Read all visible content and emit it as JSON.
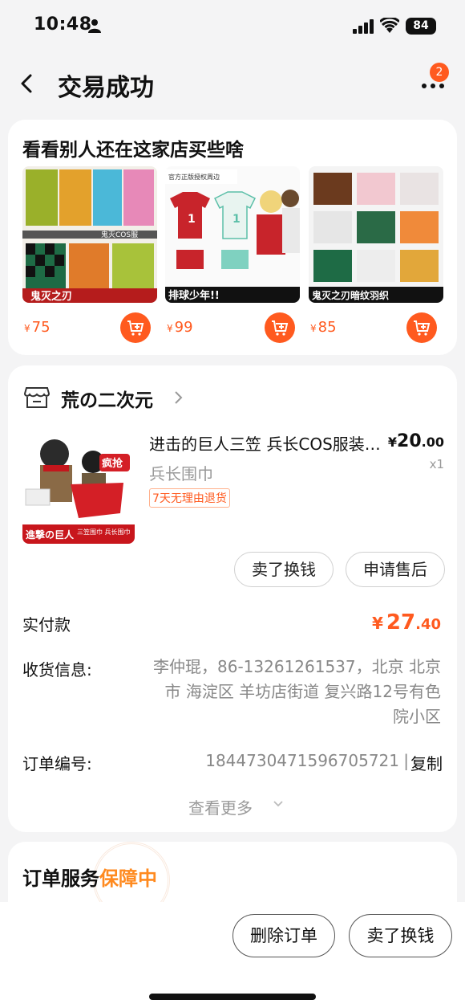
{
  "status_bar": {
    "time": "10:48",
    "battery": "84"
  },
  "header": {
    "title": "交易成功",
    "badge_count": "2"
  },
  "recommend": {
    "title": "看看别人还在这家店买些啥",
    "items": [
      {
        "currency": "¥",
        "price": "75",
        "banner": "鬼灭之刃",
        "label": "鬼灭COS服"
      },
      {
        "currency": "¥",
        "price": "99",
        "banner": "排球少年!!",
        "label": "官方正版授权周边"
      },
      {
        "currency": "¥",
        "price": "85",
        "banner": "鬼灭之刃暗纹羽织",
        "label": ""
      }
    ]
  },
  "order": {
    "shop_name": "荒の二次元",
    "product": {
      "title": "进击的巨人三笠 兵长COS服装围巾",
      "spec": "兵长围巾",
      "return_tag": "7天无理由退货",
      "price_currency": "¥",
      "price_int": "20",
      "price_dec": ".00",
      "qty": "x1",
      "img_tag": "疯抢",
      "img_banner": "進撃の巨人",
      "img_sub": "三笠围巾 兵长围巾"
    },
    "buttons": {
      "sell": "卖了换钱",
      "after_sale": "申请售后"
    },
    "paid_label": "实付款",
    "paid": {
      "currency": "¥",
      "int": "27",
      "dec": ".40"
    },
    "address_label": "收货信息:",
    "address": "李仲琨，86-13261261537，北京 北京市 海淀区 羊坊店街道 复兴路12号有色院小区",
    "order_no_label": "订单编号:",
    "order_no": "1844730471596705721",
    "copy": "复制",
    "see_more": "查看更多"
  },
  "service": {
    "title_a": "订单服务",
    "title_b": "保障中"
  },
  "bottom_bar": {
    "delete": "删除订单",
    "sell": "卖了换钱"
  },
  "colors": {
    "accent": "#ff5a1f",
    "background": "#f4f4f5",
    "muted": "#888888"
  }
}
